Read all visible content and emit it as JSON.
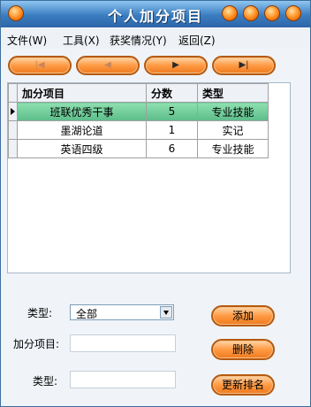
{
  "window": {
    "title": "个人加分项目"
  },
  "menu": [
    {
      "label": "文件(W)"
    },
    {
      "label": "工具(X)"
    },
    {
      "label": "获奖情况(Y)"
    },
    {
      "label": "返回(Z)"
    }
  ],
  "nav": {
    "first": "|◀",
    "prev": "◀",
    "next": "▶",
    "last": "▶|"
  },
  "table": {
    "headers": [
      "加分项目",
      "分数",
      "类型"
    ],
    "rows": [
      {
        "item": "班联优秀干事",
        "score": "5",
        "type": "专业技能"
      },
      {
        "item": "墨湖论道",
        "score": "1",
        "type": "实记"
      },
      {
        "item": "英语四级",
        "score": "6",
        "type": "专业技能"
      }
    ]
  },
  "form": {
    "type_label": "类型:",
    "type_value": "全部",
    "item_label": "加分项目:",
    "type2_label": "类型:"
  },
  "buttons": {
    "add": "添加",
    "delete": "删除",
    "refresh": "更新排名"
  }
}
